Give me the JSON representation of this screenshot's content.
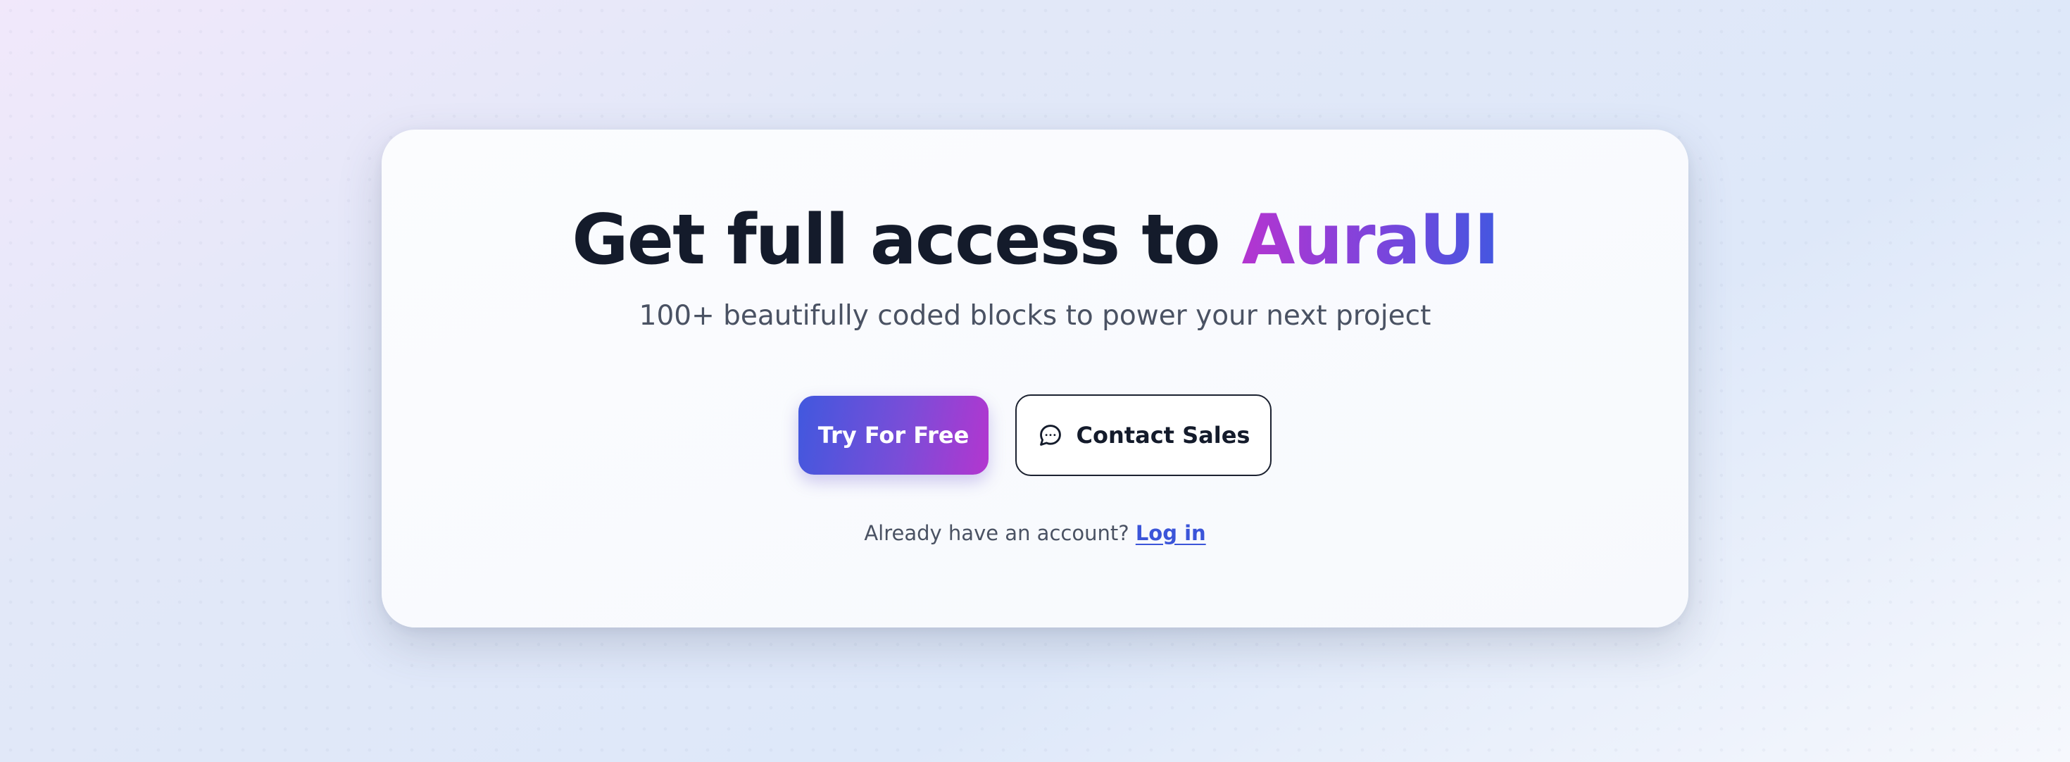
{
  "hero": {
    "headline_prefix": "Get full access to ",
    "headline_brand": "AuraUI",
    "subtitle": "100+ beautifully coded blocks to power your next project"
  },
  "actions": {
    "primary_label": "Try For Free",
    "secondary_label": "Contact Sales",
    "secondary_icon": "chat-bubble-icon"
  },
  "login": {
    "prompt": "Already have an account?",
    "link_label": "Log in"
  },
  "colors": {
    "heading": "#141b2b",
    "brand_gradient_start": "#b435d0",
    "brand_gradient_end": "#4357e0",
    "primary_button_start": "#4158de",
    "primary_button_end": "#b336cf",
    "link": "#3b55d9",
    "muted_text": "#4a5263"
  }
}
